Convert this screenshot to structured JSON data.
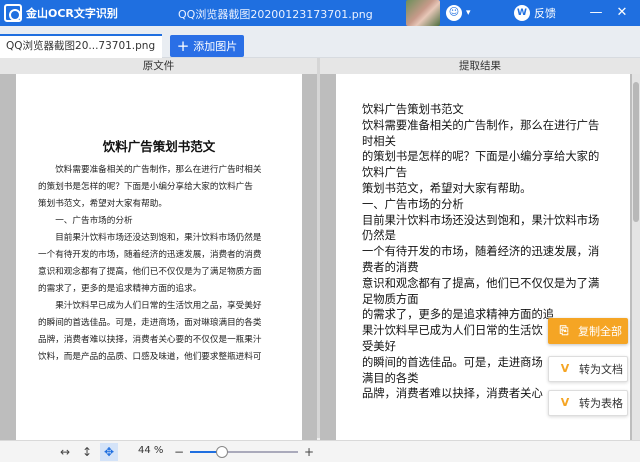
{
  "app": {
    "name": "金山OCR文字识别",
    "window_title": "QQ浏览器截图20200123173701.png",
    "feedback_label": "反馈",
    "user_icon": "shield-face-icon",
    "minimize": "—",
    "close": "✕"
  },
  "tabs": {
    "file_tab": "QQ浏览器截图20...73701.png",
    "add_image": "添加图片"
  },
  "panels": {
    "original_label": "原文件",
    "result_label": "提取结果"
  },
  "original_doc": {
    "heading": "饮料广告策划书范文",
    "lines": [
      "　　饮料需要准备相关的广告制作，那么在进行广告时相关",
      "的策划书是怎样的呢？下面是小编分享给大家的饮料广告",
      "策划书范文，希望对大家有帮助。",
      "　　一、广告市场的分析",
      "　　目前果汁饮料市场还没达到饱和，果汁饮料市场仍然是",
      "一个有待开发的市场，随着经济的迅速发展，消费者的消费",
      "意识和观念都有了提高，他们已不仅仅是为了满足物质方面",
      "的需求了，更多的是追求精神方面的追求。",
      "　　果汁饮料早已成为人们日常的生活饮用之品，享受美好",
      "的瞬间的首选佳品。可是，走进商场，面对琳琅满目的各类",
      "品牌，消费者难以抉择，消费者关心要的不仅仅是一瓶果汁",
      "饮料，而是产品的品质、口感及味道，他们要求整瓶进料可"
    ]
  },
  "result_text": {
    "lines": [
      "饮料广告策划书范文",
      "饮料需要准备相关的广告制作，那么在进行广告",
      "时相关",
      "的策划书是怎样的呢？下面是小编分享给大家的",
      "饮料广告",
      "策划书范文，希望对大家有帮助。",
      "一、广告市场的分析",
      "目前果汁饮料市场还没达到饱和，果汁饮料市场",
      "仍然是",
      "一个有待开发的市场，随着经济的迅速发展，消",
      "费者的消费",
      "意识和观念都有了提高，他们已不仅仅是为了满",
      "足物质方面",
      "的需求了，更多的是追求精神方面的追",
      "果汁饮料早已成为人们日常的生活饮",
      "受美好",
      "的瞬间的首选佳品。可是，走进商场",
      "满目的各类",
      "品牌，消费者难以抉择，消费者关心"
    ]
  },
  "actions": {
    "copy_all": "复制全部",
    "to_doc": "转为文档",
    "to_table": "转为表格",
    "accent_color": "#f5a524"
  },
  "toolbar": {
    "fit_width_icon": "↔",
    "fit_height_icon": "↕",
    "pan_icon": "✥",
    "zoom_value": "44 %",
    "zoom_out": "−",
    "zoom_in": "+",
    "zoom_fraction": 0.3
  },
  "colors": {
    "brand_blue": "#1f6fe0"
  }
}
